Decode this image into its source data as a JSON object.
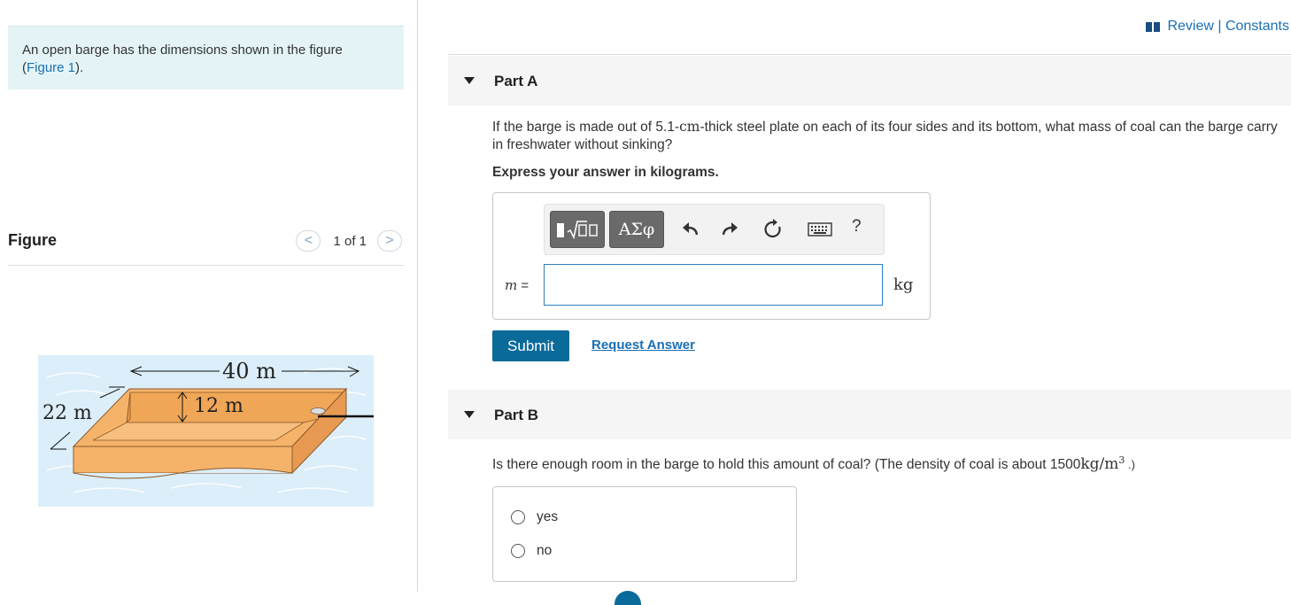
{
  "intro": {
    "text": "An open barge has the dimensions shown in the figure",
    "link": "Figure 1",
    "suffix": ")."
  },
  "figure_panel": {
    "title": "Figure",
    "pager": "1 of 1",
    "prev": "<",
    "next": ">"
  },
  "figure_labels": {
    "length": "40 m",
    "height": "12 m",
    "width": "22 m"
  },
  "header": {
    "review": "Review",
    "sep": " | ",
    "constants": "Constants"
  },
  "partA": {
    "title": "Part A",
    "question_pre": "If the barge is made out of 5.1-",
    "question_unit": "cm",
    "question_post": "-thick steel plate on each of its four sides and its bottom, what mass of coal can the barge carry in freshwater without sinking?",
    "express": "Express your answer in kilograms.",
    "toolbar_greek": "ΑΣφ",
    "help": "?",
    "var": "m",
    "equals": " =",
    "input_value": "",
    "unit": "kg",
    "submit": "Submit",
    "request": "Request Answer"
  },
  "partB": {
    "title": "Part B",
    "question_pre": "Is there enough room in the barge to hold this amount of coal? (The density of coal is about 1500",
    "question_unit": "kg/m",
    "question_exp": "3",
    "question_post": " .)",
    "options": [
      "yes",
      "no"
    ]
  }
}
